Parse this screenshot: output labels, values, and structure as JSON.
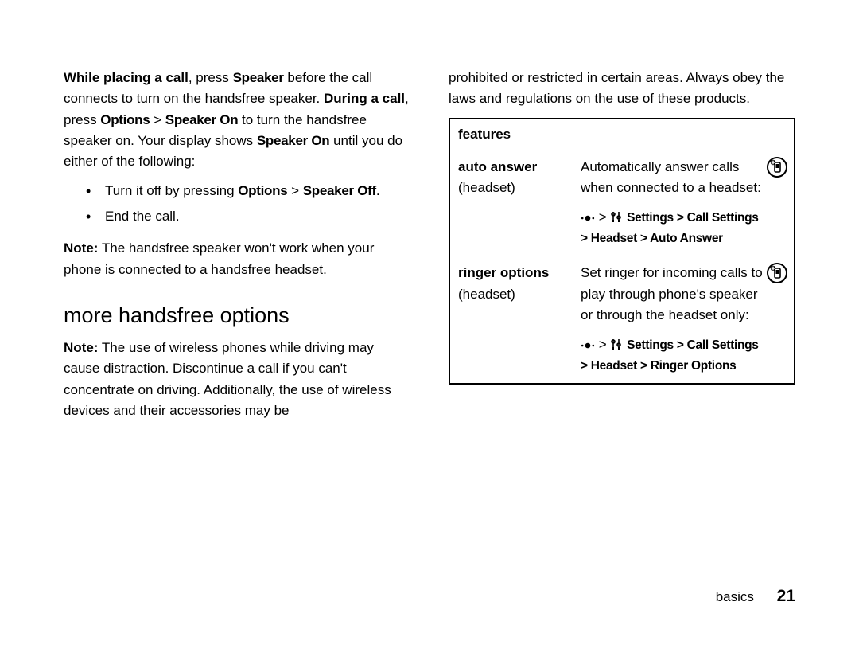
{
  "left": {
    "p1_a": "While placing a call",
    "p1_b": ", press ",
    "p1_speaker": "Speaker",
    "p1_c": " before the call connects to turn on the handsfree speaker. ",
    "p1_d": "During a call",
    "p1_e": ", press ",
    "p1_opts": "Options",
    "p1_gt": " > ",
    "p1_spon": "Speaker On",
    "p1_f": " to turn the handsfree speaker on. Your display shows ",
    "p1_spon2": "Speaker On",
    "p1_g": " until you do either of the following:",
    "bullet1_a": "Turn it off by pressing ",
    "bullet1_opts": "Options",
    "bullet1_gt": " > ",
    "bullet1_spoff": "Speaker Off",
    "bullet1_b": ".",
    "bullet2": "End the call.",
    "note_lbl": "Note:",
    "note_txt": " The handsfree speaker won't work when your phone is connected to a handsfree headset.",
    "heading": "more handsfree options",
    "note2_lbl": "Note:",
    "note2_txt": " The use of wireless phones while driving may cause distraction. Discontinue a call if you can't concentrate on driving. Additionally, the use of wireless devices and their accessories may be "
  },
  "right": {
    "cont": "prohibited or restricted in certain areas. Always obey the laws and regulations on the use of these products.",
    "table_header": "features",
    "rows": [
      {
        "name": "auto answer",
        "sub": "(headset)",
        "desc": "Automatically answer calls when connected to a headset:",
        "path": " Settings > Call Settings > Headset > Auto Answer"
      },
      {
        "name": "ringer options",
        "sub": "(headset)",
        "desc": "Set ringer for incoming calls to play through phone's speaker or through the headset only:",
        "path": " Settings > Call Settings > Headset > Ringer Options"
      }
    ]
  },
  "nav_sep": " > ",
  "footer": {
    "section": "basics",
    "page": "21"
  }
}
